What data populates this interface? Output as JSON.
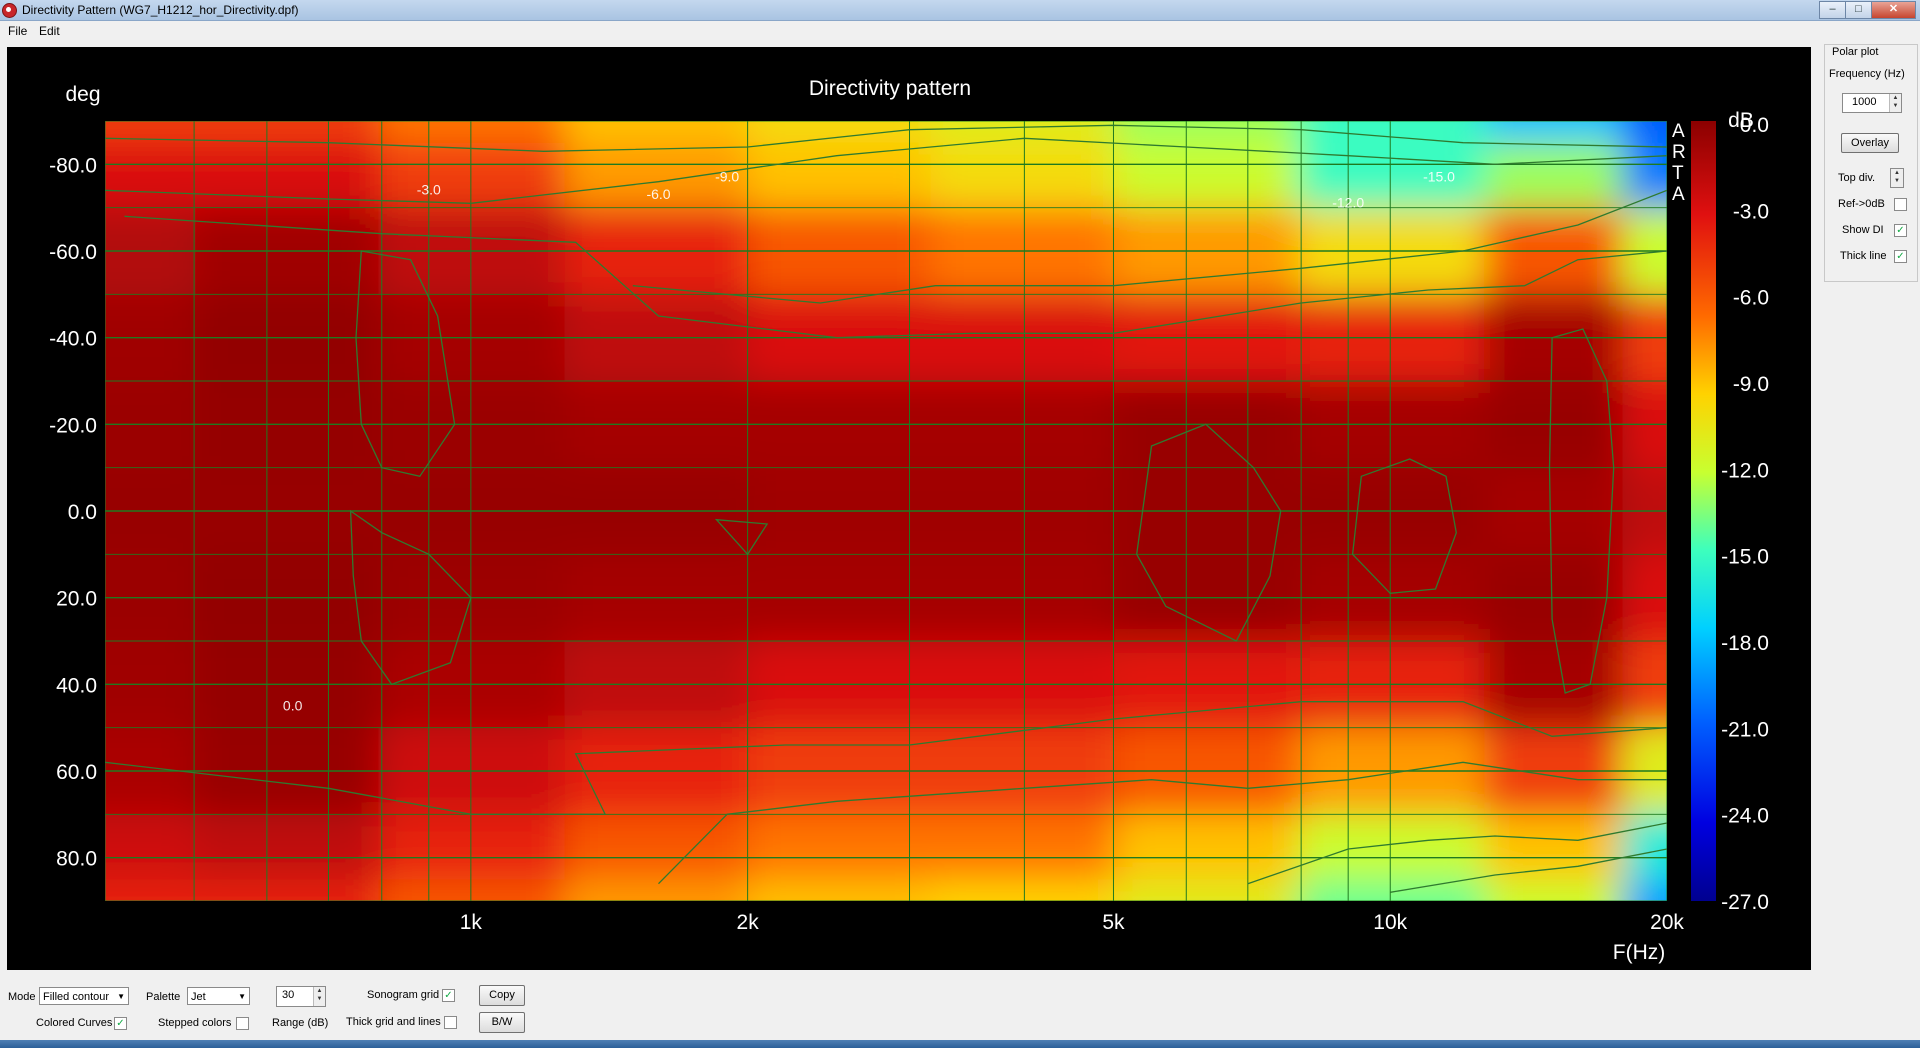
{
  "window": {
    "title": "Directivity Pattern  (WG7_H1212_hor_Directivity.dpf)"
  },
  "menu": {
    "items": [
      "File",
      "Edit"
    ]
  },
  "plot": {
    "title": "Directivity pattern",
    "y_unit": "deg",
    "x_unit": "F(Hz)",
    "colorbar_unit": "dB",
    "watermark": "ARTA",
    "y_ticks": [
      "-80.0",
      "-60.0",
      "-40.0",
      "-20.0",
      "0.0",
      "20.0",
      "40.0",
      "60.0",
      "80.0"
    ],
    "x_ticks": [
      "1k",
      "2k",
      "5k",
      "10k",
      "20k"
    ],
    "colorbar_ticks": [
      "0.0",
      "-3.0",
      "-6.0",
      "-9.0",
      "-12.0",
      "-15.0",
      "-18.0",
      "-21.0",
      "-24.0",
      "-27.0"
    ],
    "contour_labels": [
      "-3.0",
      "-6.0",
      "-9.0",
      "-12.0",
      "-15.0",
      "0.0"
    ]
  },
  "chart_data": {
    "type": "heatmap",
    "title": "Directivity pattern",
    "xlabel": "F(Hz)",
    "ylabel": "deg",
    "x_scale": "log",
    "xlim": [
      400,
      20000
    ],
    "ylim": [
      -90,
      90
    ],
    "colorbar": {
      "label": "dB",
      "range": [
        -27,
        0
      ],
      "palette": "Jet"
    },
    "x_ticks": [
      1000,
      2000,
      5000,
      10000,
      20000
    ],
    "y_ticks": [
      -80,
      -60,
      -40,
      -20,
      0,
      20,
      40,
      60,
      80
    ],
    "grid": true,
    "contours": [
      0,
      -3,
      -6,
      -9,
      -12,
      -15
    ],
    "frequencies": [
      400,
      630,
      1000,
      1600,
      2500,
      4000,
      6300,
      10000,
      16000,
      20000
    ],
    "angles": [
      -90,
      -80,
      -60,
      -40,
      -20,
      0,
      20,
      40,
      60,
      80,
      90
    ],
    "values": [
      [
        -5,
        -5,
        -7,
        -9,
        -10,
        -11,
        -13,
        -15,
        -18,
        -21
      ],
      [
        -3,
        -3,
        -5,
        -8,
        -9,
        -10,
        -12,
        -15,
        -13,
        -20
      ],
      [
        -1.5,
        -0.8,
        -2,
        -4,
        -6,
        -7,
        -8,
        -10,
        -6,
        -12
      ],
      [
        -0.8,
        -0.3,
        -1,
        -2,
        -3,
        -3,
        -3.5,
        -4,
        -1,
        -5
      ],
      [
        -0.6,
        -0.4,
        -0.6,
        -1,
        -1,
        -1,
        -0.5,
        -1,
        -0.5,
        -3
      ],
      [
        -0.5,
        -0.5,
        -0.5,
        -0.5,
        -0.8,
        -0.8,
        -0.5,
        -0.5,
        -1,
        -2
      ],
      [
        -0.6,
        -0.3,
        -0.7,
        -1,
        -1,
        -1,
        -0.5,
        -1,
        -0.5,
        -3
      ],
      [
        -0.8,
        -0.4,
        -1.2,
        -2,
        -3,
        -3,
        -3.5,
        -4,
        -1,
        -5
      ],
      [
        -1.2,
        -0.5,
        -2.5,
        -4,
        -5,
        -5,
        -6,
        -8,
        -5,
        -11
      ],
      [
        -2.5,
        -2,
        -4,
        -6,
        -7,
        -7,
        -9,
        -12,
        -9,
        -16
      ],
      [
        -4,
        -4,
        -6,
        -8,
        -9,
        -9.5,
        -11,
        -14,
        -12,
        -19
      ]
    ]
  },
  "panel": {
    "polar_plot_label": "Polar plot",
    "frequency_label": "Frequency (Hz)",
    "frequency_value": "1000",
    "overlay_label": "Overlay",
    "top_div_label": "Top div.",
    "ref_label": "Ref->0dB",
    "ref_checked": false,
    "show_di_label": "Show DI",
    "show_di_checked": true,
    "thick_line_label": "Thick line",
    "thick_line_checked": true
  },
  "bottom": {
    "mode_label": "Mode",
    "mode_value": "Filled contour",
    "palette_label": "Palette",
    "palette_value": "Jet",
    "range_value": "30",
    "sonogram_grid_label": "Sonogram grid",
    "sonogram_grid_checked": true,
    "copy_label": "Copy",
    "colored_curves_label": "Colored Curves",
    "colored_curves_checked": true,
    "stepped_colors_label": "Stepped colors",
    "stepped_colors_checked": false,
    "range_label": "Range (dB)",
    "thick_grid_label": "Thick grid and  lines",
    "thick_grid_checked": false,
    "bw_label": "B/W"
  },
  "check_glyph": "✓"
}
